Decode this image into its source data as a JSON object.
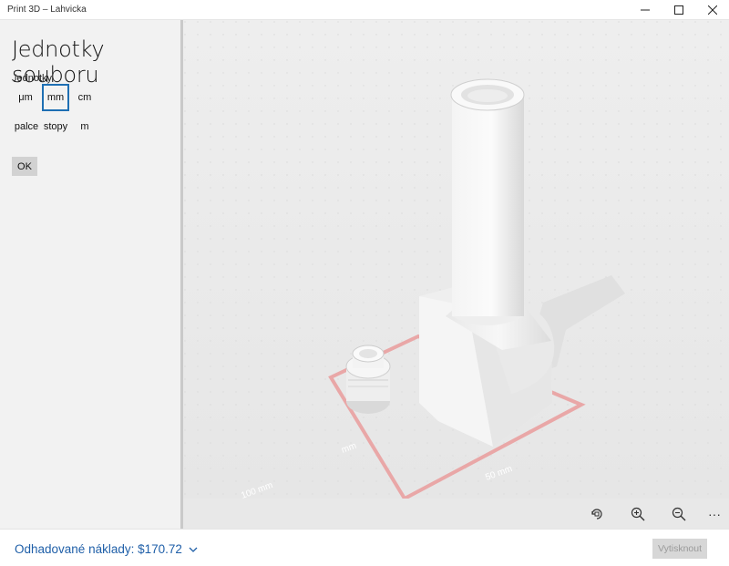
{
  "window": {
    "title": "Print 3D – Lahvicka",
    "minimize_glyph": "—",
    "maximize_glyph": "☐",
    "close_glyph": "✕"
  },
  "panel": {
    "heading": "Jednotky souboru",
    "units_label": "Jednotky",
    "units": [
      "μm",
      "mm",
      "cm",
      "palce",
      "stopy",
      "m"
    ],
    "selected_unit": "mm",
    "ok_label": "OK"
  },
  "viewport": {
    "measure_labels": {
      "mm_small": "mm",
      "mm_left": "mm",
      "mm_50": "50 mm",
      "mm_100": "100 mm"
    }
  },
  "toolbar": {
    "icons": [
      "rotate-view-icon",
      "zoom-in-icon",
      "zoom-out-icon",
      "more-icon"
    ],
    "more_glyph": "···"
  },
  "footer": {
    "cost_label": "Odhadované náklady: $170.72",
    "print_label": "Vytisknout"
  },
  "colors": {
    "accent": "#1e6fb3",
    "link": "#1f5fa8",
    "print_area": "#e57a7a"
  }
}
